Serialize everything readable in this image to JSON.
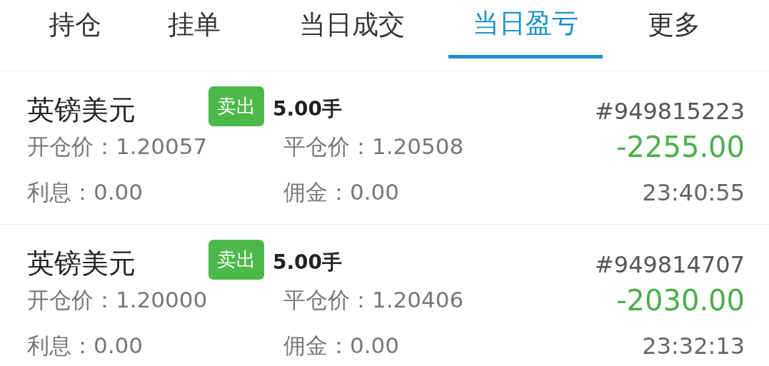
{
  "tabs": [
    {
      "label": "持仓",
      "selected": false
    },
    {
      "label": "挂单",
      "selected": false
    },
    {
      "label": "当日成交",
      "selected": false
    },
    {
      "label": "当日盈亏",
      "selected": true
    },
    {
      "label": "更多",
      "selected": false
    }
  ],
  "orders": [
    {
      "symbol": "英镑美元",
      "side": {
        "label": "卖出",
        "kind": "sell"
      },
      "lots": "5.00手",
      "ticket": "#949815223",
      "open_label": "开仓价：",
      "open_price": "1.20057",
      "close_label": "平仓价：",
      "close_price": "1.20508",
      "profit": "-2255.00",
      "interest_label": "利息：",
      "interest": "0.00",
      "commission_label": "佣金：",
      "commission": "0.00",
      "time": "23:40:55"
    },
    {
      "symbol": "英镑美元",
      "side": {
        "label": "卖出",
        "kind": "sell"
      },
      "lots": "5.00手",
      "ticket": "#949814707",
      "open_label": "开仓价：",
      "open_price": "1.20000",
      "close_label": "平仓价：",
      "close_price": "1.20406",
      "profit": "-2030.00",
      "interest_label": "利息：",
      "interest": "0.00",
      "commission_label": "佣金：",
      "commission": "0.00",
      "time": "23:32:13"
    }
  ]
}
